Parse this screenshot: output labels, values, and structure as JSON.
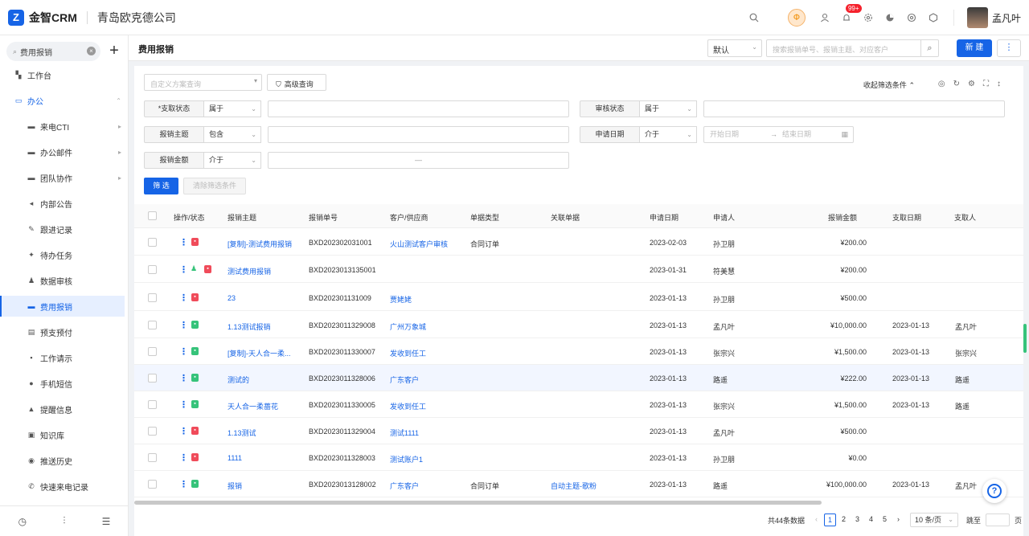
{
  "app": {
    "logo_mark": "Z",
    "name": "金智CRM",
    "company": "青岛欧克德公司",
    "notify_badge": "99+",
    "user_name": "孟凡叶",
    "orange_icon_text": "Ф"
  },
  "sidebar": {
    "search_value": "费用报销",
    "items": [
      {
        "label": "工作台",
        "icon": "dashboard-icon"
      },
      {
        "label": "办公",
        "icon": "office-icon"
      },
      {
        "label": "来电CTI",
        "icon": "folder-icon"
      },
      {
        "label": "办公邮件",
        "icon": "folder-icon"
      },
      {
        "label": "团队协作",
        "icon": "folder-icon"
      },
      {
        "label": "内部公告",
        "icon": "megaphone-icon"
      },
      {
        "label": "跟进记录",
        "icon": "edit-icon"
      },
      {
        "label": "待办任务",
        "icon": "pin-icon"
      },
      {
        "label": "数据审核",
        "icon": "stamp-icon"
      },
      {
        "label": "费用报销",
        "icon": "card-icon"
      },
      {
        "label": "预支预付",
        "icon": "receipt-icon"
      },
      {
        "label": "工作请示",
        "icon": "chat-icon"
      },
      {
        "label": "手机短信",
        "icon": "message-icon"
      },
      {
        "label": "提醒信息",
        "icon": "bell-icon"
      },
      {
        "label": "知识库",
        "icon": "book-icon"
      },
      {
        "label": "推送历史",
        "icon": "history-icon"
      },
      {
        "label": "快速来电记录",
        "icon": "phone-icon"
      }
    ]
  },
  "header": {
    "title": "费用报销",
    "view_select": "默认",
    "search_placeholder": "搜索报销单号、报销主题、对应客户",
    "new_button": "新 建",
    "more_button": "⋮"
  },
  "filter": {
    "scheme_placeholder": "自定义方案查询",
    "advanced_button": "高级查询",
    "collapse_label": "收起筛选条件",
    "fields": [
      {
        "label": "*支取状态",
        "op": "属于"
      },
      {
        "label": "审核状态",
        "op": "属于"
      },
      {
        "label": "报销主题",
        "op": "包含"
      },
      {
        "label": "申请日期",
        "op": "介于"
      },
      {
        "label": "报销金额",
        "op": "介于"
      }
    ],
    "date_start_placeholder": "开始日期",
    "date_arrow": "→",
    "date_end_placeholder": "结束日期",
    "range_sep": "—",
    "filter_button": "筛 选",
    "clear_button": "清除筛选条件"
  },
  "table": {
    "columns": [
      "操作/状态",
      "报销主题",
      "报销单号",
      "客户/供应商",
      "单据类型",
      "关联单据",
      "申请日期",
      "申请人",
      "报销金额",
      "支取日期",
      "支取人"
    ],
    "rows": [
      {
        "subject": "[复制]-测试费用报销",
        "no": "BXD202302031001",
        "customer": "火山测试客户审核",
        "doc_type": "合同订单",
        "related": "",
        "date": "2023-02-03",
        "applicant": "孙卫朋",
        "amount": "¥200.00",
        "pay_date": "",
        "payer": "",
        "status": "red"
      },
      {
        "subject": "测试费用报销",
        "no": "BXD2023013135001",
        "customer": "",
        "doc_type": "",
        "related": "",
        "date": "2023-01-31",
        "applicant": "符美慧",
        "amount": "¥200.00",
        "pay_date": "",
        "payer": "",
        "status": "user-red"
      },
      {
        "subject": "23",
        "no": "BXD202301131009",
        "customer": "贾姥姥",
        "doc_type": "",
        "related": "",
        "date": "2023-01-13",
        "applicant": "孙卫朋",
        "amount": "¥500.00",
        "pay_date": "",
        "payer": "",
        "status": "red"
      },
      {
        "subject": "1.13测试报销",
        "no": "BXD2023011329008",
        "customer": "广州万象城",
        "doc_type": "",
        "related": "",
        "date": "2023-01-13",
        "applicant": "孟凡叶",
        "amount": "¥10,000.00",
        "pay_date": "2023-01-13",
        "payer": "孟凡叶",
        "status": "green"
      },
      {
        "subject": "[复制]-天人合一柔...",
        "no": "BXD2023011330007",
        "customer": "发收到任工",
        "doc_type": "",
        "related": "",
        "date": "2023-01-13",
        "applicant": "张宗兴",
        "amount": "¥1,500.00",
        "pay_date": "2023-01-13",
        "payer": "张宗兴",
        "status": "green"
      },
      {
        "subject": "测试的",
        "no": "BXD2023011328006",
        "customer": "广东客户",
        "doc_type": "",
        "related": "",
        "date": "2023-01-13",
        "applicant": "路遥",
        "amount": "¥222.00",
        "pay_date": "2023-01-13",
        "payer": "路遥",
        "status": "green"
      },
      {
        "subject": "天人合一柔蔷花",
        "no": "BXD2023011330005",
        "customer": "发收到任工",
        "doc_type": "",
        "related": "",
        "date": "2023-01-13",
        "applicant": "张宗兴",
        "amount": "¥1,500.00",
        "pay_date": "2023-01-13",
        "payer": "路遥",
        "status": "green"
      },
      {
        "subject": "1.13测试",
        "no": "BXD2023011329004",
        "customer": "测试1111",
        "doc_type": "",
        "related": "",
        "date": "2023-01-13",
        "applicant": "孟凡叶",
        "amount": "¥500.00",
        "pay_date": "",
        "payer": "",
        "status": "red"
      },
      {
        "subject": "1111",
        "no": "BXD2023011328003",
        "customer": "测试账户1",
        "doc_type": "",
        "related": "",
        "date": "2023-01-13",
        "applicant": "孙卫朋",
        "amount": "¥0.00",
        "pay_date": "",
        "payer": "",
        "status": "red"
      },
      {
        "subject": "报销",
        "no": "BXD2023013128002",
        "customer": "广东客户",
        "doc_type": "合同订单",
        "related": "自动主题-歌粉",
        "date": "2023-01-13",
        "applicant": "路遥",
        "amount": "¥100,000.00",
        "pay_date": "2023-01-13",
        "payer": "孟凡叶",
        "status": "green"
      }
    ]
  },
  "pagination": {
    "total": "共44条数据",
    "prev": "‹",
    "pages": [
      "1",
      "2",
      "3",
      "4",
      "5"
    ],
    "next": "›",
    "current": "1",
    "page_size": "10 条/页",
    "jump_label": "跳至",
    "page_unit": "页"
  },
  "help": {
    "label": "?"
  },
  "colors": {
    "accent": "#1664e6",
    "red_tag": "#f04b5a",
    "green_tag": "#36c37a"
  }
}
